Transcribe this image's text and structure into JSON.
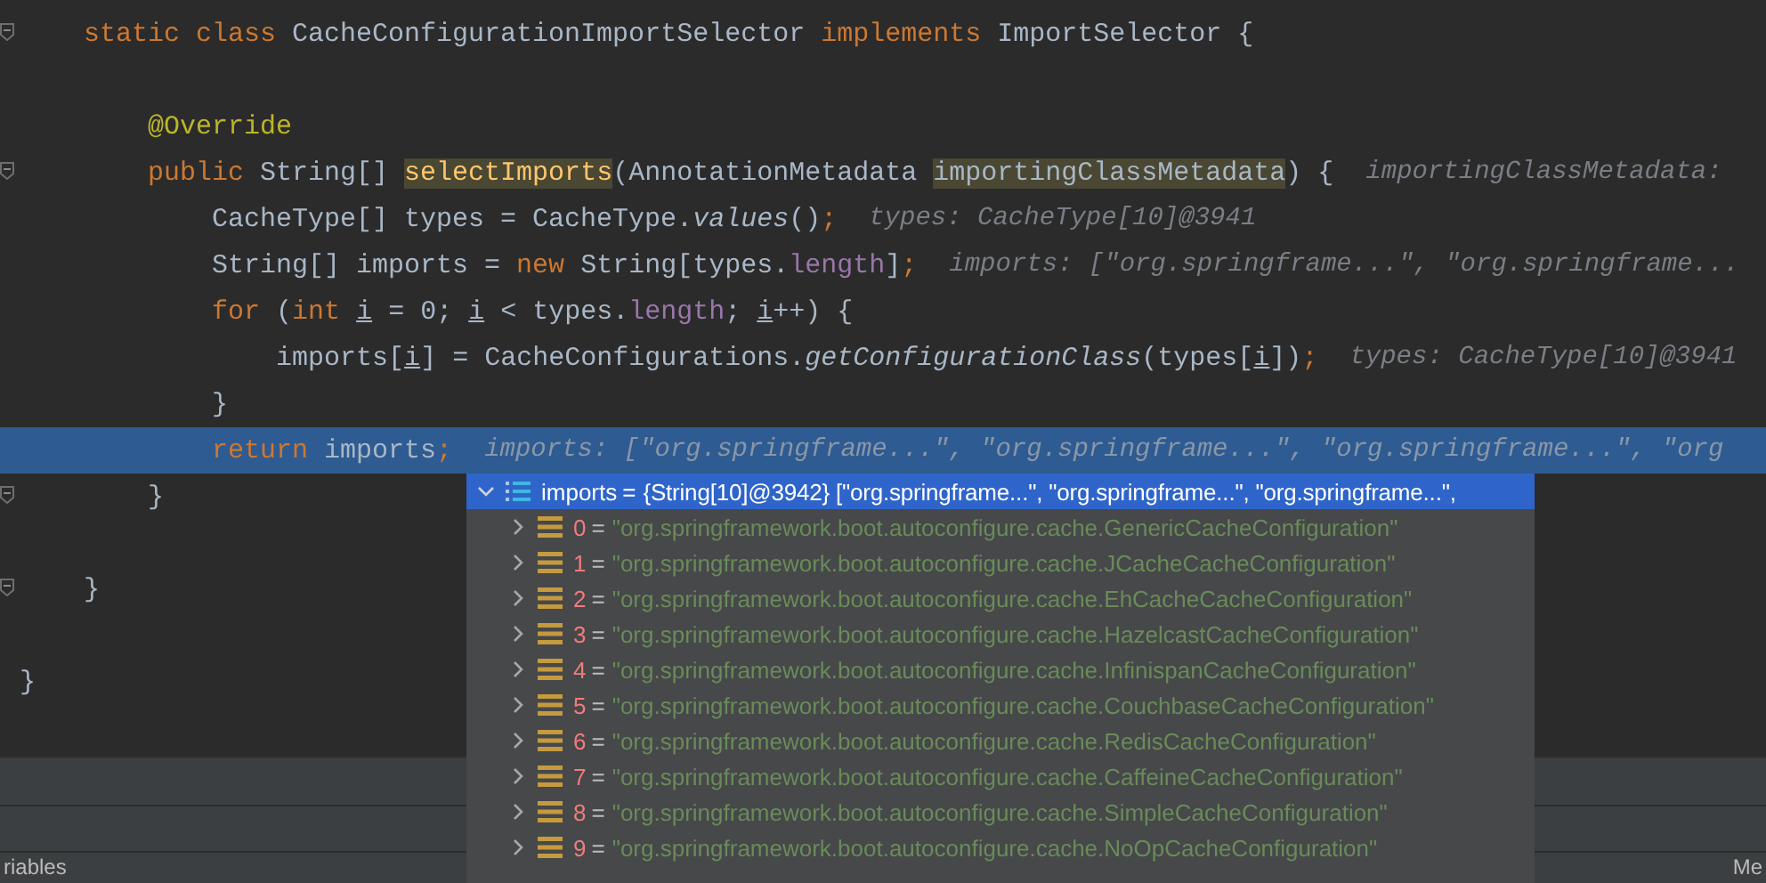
{
  "editor": {
    "lines": [
      {
        "fold": true,
        "current": false,
        "tokens": [
          {
            "kind": "keyword",
            "text": "    static class "
          },
          {
            "kind": "plain",
            "text": "CacheConfigurationImportSelector "
          },
          {
            "kind": "keyword",
            "text": "implements "
          },
          {
            "kind": "plain",
            "text": "ImportSelector {"
          }
        ]
      },
      {
        "fold": false,
        "current": false
      },
      {
        "fold": false,
        "current": false,
        "tokens": [
          {
            "kind": "annotation",
            "text": "        @Override"
          }
        ]
      },
      {
        "fold": true,
        "current": false,
        "tokens": [
          {
            "kind": "keyword",
            "text": "        public "
          },
          {
            "kind": "plain",
            "text": "String[] "
          },
          {
            "kind": "method-decl",
            "text": "selectImports"
          },
          {
            "kind": "plain",
            "text": "(AnnotationMetadata "
          },
          {
            "kind": "param",
            "text": "importingClassMetadata"
          },
          {
            "kind": "plain",
            "text": ") {"
          },
          {
            "kind": "hint",
            "text": "importingClassMetadata:"
          }
        ]
      },
      {
        "fold": false,
        "current": false,
        "tokens": [
          {
            "kind": "plain",
            "text": "            CacheType[] types = CacheType."
          },
          {
            "kind": "static-call",
            "text": "values"
          },
          {
            "kind": "plain",
            "text": "()"
          },
          {
            "kind": "keyword",
            "text": ";"
          },
          {
            "kind": "hint",
            "text": "types: CacheType[10]@3941"
          }
        ]
      },
      {
        "fold": false,
        "current": false,
        "tokens": [
          {
            "kind": "plain",
            "text": "            String[] imports = "
          },
          {
            "kind": "keyword",
            "text": "new "
          },
          {
            "kind": "plain",
            "text": "String[types."
          },
          {
            "kind": "field",
            "text": "length"
          },
          {
            "kind": "plain",
            "text": "]"
          },
          {
            "kind": "keyword",
            "text": ";"
          },
          {
            "kind": "hint",
            "text": "imports: [\"org.springframe...\", \"org.springframe..."
          }
        ]
      },
      {
        "fold": false,
        "current": false,
        "tokens": [
          {
            "kind": "keyword",
            "text": "            for "
          },
          {
            "kind": "plain",
            "text": "("
          },
          {
            "kind": "keyword",
            "text": "int "
          },
          {
            "kind": "var",
            "text": "i"
          },
          {
            "kind": "plain",
            "text": " = 0; "
          },
          {
            "kind": "var",
            "text": "i"
          },
          {
            "kind": "plain",
            "text": " < types."
          },
          {
            "kind": "field",
            "text": "length"
          },
          {
            "kind": "plain",
            "text": "; "
          },
          {
            "kind": "var",
            "text": "i"
          },
          {
            "kind": "plain",
            "text": "++) {"
          }
        ]
      },
      {
        "fold": false,
        "current": false,
        "tokens": [
          {
            "kind": "plain",
            "text": "                imports["
          },
          {
            "kind": "var",
            "text": "i"
          },
          {
            "kind": "plain",
            "text": "] = CacheConfigurations."
          },
          {
            "kind": "static-call",
            "text": "getConfigurationClass"
          },
          {
            "kind": "plain",
            "text": "(types["
          },
          {
            "kind": "var",
            "text": "i"
          },
          {
            "kind": "plain",
            "text": "])"
          },
          {
            "kind": "keyword",
            "text": ";"
          },
          {
            "kind": "hint",
            "text": "types: CacheType[10]@3941"
          }
        ]
      },
      {
        "fold": false,
        "current": false,
        "tokens": [
          {
            "kind": "plain",
            "text": "            }"
          }
        ]
      },
      {
        "fold": false,
        "current": true,
        "tokens": [
          {
            "kind": "keyword",
            "text": "            return "
          },
          {
            "kind": "plain",
            "text": "imports"
          },
          {
            "kind": "keyword",
            "text": ";"
          },
          {
            "kind": "hint",
            "text": "imports: [\"org.springframe...\", \"org.springframe...\", \"org.springframe...\", \"org"
          }
        ]
      },
      {
        "fold": true,
        "current": false,
        "tokens": [
          {
            "kind": "plain",
            "text": "        }"
          }
        ]
      },
      {
        "fold": false,
        "current": false
      },
      {
        "fold": true,
        "current": false,
        "tokens": [
          {
            "kind": "plain",
            "text": "    }"
          }
        ]
      },
      {
        "fold": false,
        "current": false
      },
      {
        "fold": false,
        "current": false,
        "tokens": [
          {
            "kind": "plain",
            "text": "}"
          }
        ]
      }
    ]
  },
  "popup": {
    "root": {
      "name": "imports",
      "separator": "=",
      "value": "{String[10]@3942} [\"org.springframe...\", \"org.springframe...\", \"org.springframe...\",",
      "expanded": true,
      "selected": true,
      "children": [
        {
          "name": "0",
          "separator": "=",
          "value": "\"org.springframework.boot.autoconfigure.cache.GenericCacheConfiguration\"",
          "expanded": false,
          "selected": false
        },
        {
          "name": "1",
          "separator": "=",
          "value": "\"org.springframework.boot.autoconfigure.cache.JCacheCacheConfiguration\"",
          "expanded": false,
          "selected": false
        },
        {
          "name": "2",
          "separator": "=",
          "value": "\"org.springframework.boot.autoconfigure.cache.EhCacheCacheConfiguration\"",
          "expanded": false,
          "selected": false
        },
        {
          "name": "3",
          "separator": "=",
          "value": "\"org.springframework.boot.autoconfigure.cache.HazelcastCacheConfiguration\"",
          "expanded": false,
          "selected": false
        },
        {
          "name": "4",
          "separator": "=",
          "value": "\"org.springframework.boot.autoconfigure.cache.InfinispanCacheConfiguration\"",
          "expanded": false,
          "selected": false
        },
        {
          "name": "5",
          "separator": "=",
          "value": "\"org.springframework.boot.autoconfigure.cache.CouchbaseCacheConfiguration\"",
          "expanded": false,
          "selected": false
        },
        {
          "name": "6",
          "separator": "=",
          "value": "\"org.springframework.boot.autoconfigure.cache.RedisCacheConfiguration\"",
          "expanded": false,
          "selected": false
        },
        {
          "name": "7",
          "separator": "=",
          "value": "\"org.springframework.boot.autoconfigure.cache.CaffeineCacheConfiguration\"",
          "expanded": false,
          "selected": false
        },
        {
          "name": "8",
          "separator": "=",
          "value": "\"org.springframework.boot.autoconfigure.cache.SimpleCacheConfiguration\"",
          "expanded": false,
          "selected": false
        },
        {
          "name": "9",
          "separator": "=",
          "value": "\"org.springframework.boot.autoconfigure.cache.NoOpCacheConfiguration\"",
          "expanded": false,
          "selected": false
        }
      ]
    }
  },
  "bottom_tabs": [
    {
      "label": "riables"
    },
    {
      "label": "Me"
    }
  ]
}
